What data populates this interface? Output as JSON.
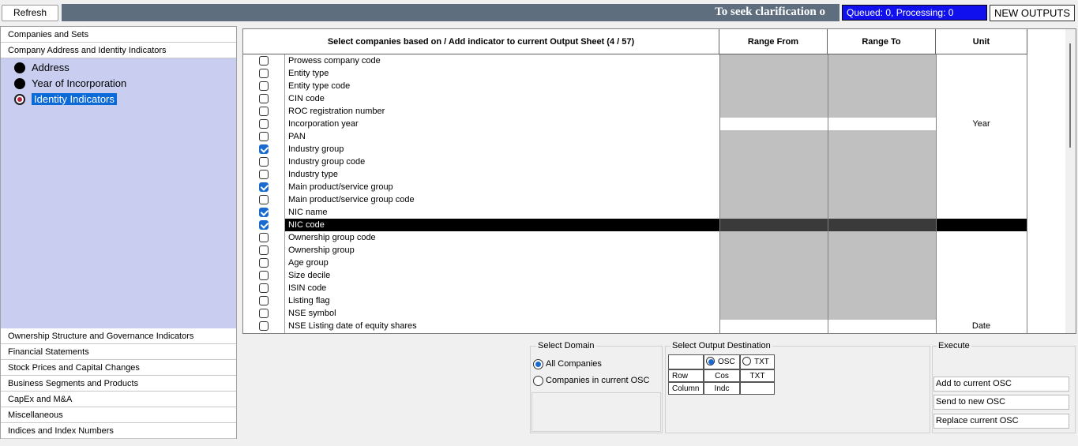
{
  "toolbar": {
    "refresh_label": "Refresh",
    "banner_text": "To seek clarification o",
    "queue_status": "Queued: 0, Processing: 0",
    "new_outputs_label": "NEW OUTPUTS"
  },
  "left_panel": {
    "top_categories": [
      "Companies and Sets",
      "Company Address and Identity Indicators"
    ],
    "tree_items": [
      {
        "label": "Address",
        "selected": false
      },
      {
        "label": "Year of Incorporation",
        "selected": false
      },
      {
        "label": "Identity Indicators",
        "selected": true
      }
    ],
    "bottom_categories": [
      "Ownership Structure and Governance Indicators",
      "Financial Statements",
      "Stock Prices and Capital Changes",
      "Business Segments and Products",
      "CapEx and M&A",
      "Miscellaneous",
      "Indices and Index Numbers"
    ]
  },
  "grid": {
    "headers": {
      "indicator": "Select companies based on / Add indicator to current Output Sheet (4 / 57)",
      "range_from": "Range From",
      "range_to": "Range To",
      "unit": "Unit"
    },
    "rows": [
      {
        "label": "Prowess company code",
        "checked": false,
        "unit": "",
        "range": "disabled"
      },
      {
        "label": "Entity type",
        "checked": false,
        "unit": "",
        "range": "disabled"
      },
      {
        "label": "Entity type code",
        "checked": false,
        "unit": "",
        "range": "disabled"
      },
      {
        "label": "CIN code",
        "checked": false,
        "unit": "",
        "range": "disabled"
      },
      {
        "label": "ROC registration number",
        "checked": false,
        "unit": "",
        "range": "disabled"
      },
      {
        "label": "Incorporation year",
        "checked": false,
        "unit": "Year",
        "range": "enabled"
      },
      {
        "label": "PAN",
        "checked": false,
        "unit": "",
        "range": "disabled"
      },
      {
        "label": "Industry group",
        "checked": true,
        "unit": "",
        "range": "disabled"
      },
      {
        "label": "Industry group code",
        "checked": false,
        "unit": "",
        "range": "disabled"
      },
      {
        "label": "Industry type",
        "checked": false,
        "unit": "",
        "range": "disabled"
      },
      {
        "label": "Main product/service group",
        "checked": true,
        "unit": "",
        "range": "disabled"
      },
      {
        "label": "Main product/service group code",
        "checked": false,
        "unit": "",
        "range": "disabled"
      },
      {
        "label": "NIC name",
        "checked": true,
        "unit": "",
        "range": "disabled"
      },
      {
        "label": "NIC code",
        "checked": true,
        "unit": "",
        "range": "highlighted"
      },
      {
        "label": "Ownership group code",
        "checked": false,
        "unit": "",
        "range": "disabled"
      },
      {
        "label": "Ownership group",
        "checked": false,
        "unit": "",
        "range": "disabled"
      },
      {
        "label": "Age group",
        "checked": false,
        "unit": "",
        "range": "disabled"
      },
      {
        "label": "Size decile",
        "checked": false,
        "unit": "",
        "range": "disabled"
      },
      {
        "label": "ISIN code",
        "checked": false,
        "unit": "",
        "range": "disabled"
      },
      {
        "label": "Listing flag",
        "checked": false,
        "unit": "",
        "range": "disabled"
      },
      {
        "label": "NSE symbol",
        "checked": false,
        "unit": "",
        "range": "disabled"
      },
      {
        "label": "NSE Listing date of equity shares",
        "checked": false,
        "unit": "Date",
        "range": "enabled"
      }
    ]
  },
  "domain": {
    "title": "Select Domain",
    "options": [
      {
        "label": "All Companies",
        "selected": true
      },
      {
        "label": "Companies in current OSC",
        "selected": false
      }
    ]
  },
  "destination": {
    "title": "Select Output Destination",
    "osc_label": "OSC",
    "txt_label": "TXT",
    "osc_selected": true,
    "row_label": "Row",
    "column_label": "Column",
    "row_osc": "Cos",
    "row_txt": "TXT",
    "col_osc": "Indc",
    "col_txt": ""
  },
  "execute": {
    "title": "Execute",
    "add_label": "Add to current OSC",
    "send_label": "Send to new OSC",
    "replace_label": "Replace current OSC"
  },
  "colors": {
    "banner": "#5e6e7e",
    "queue_bg": "#1010ee",
    "tree_bg": "#c9cdf0",
    "selection": "#0b6ad8",
    "disabled_cell": "#c0c0c0",
    "highlight_row": "#000000"
  }
}
